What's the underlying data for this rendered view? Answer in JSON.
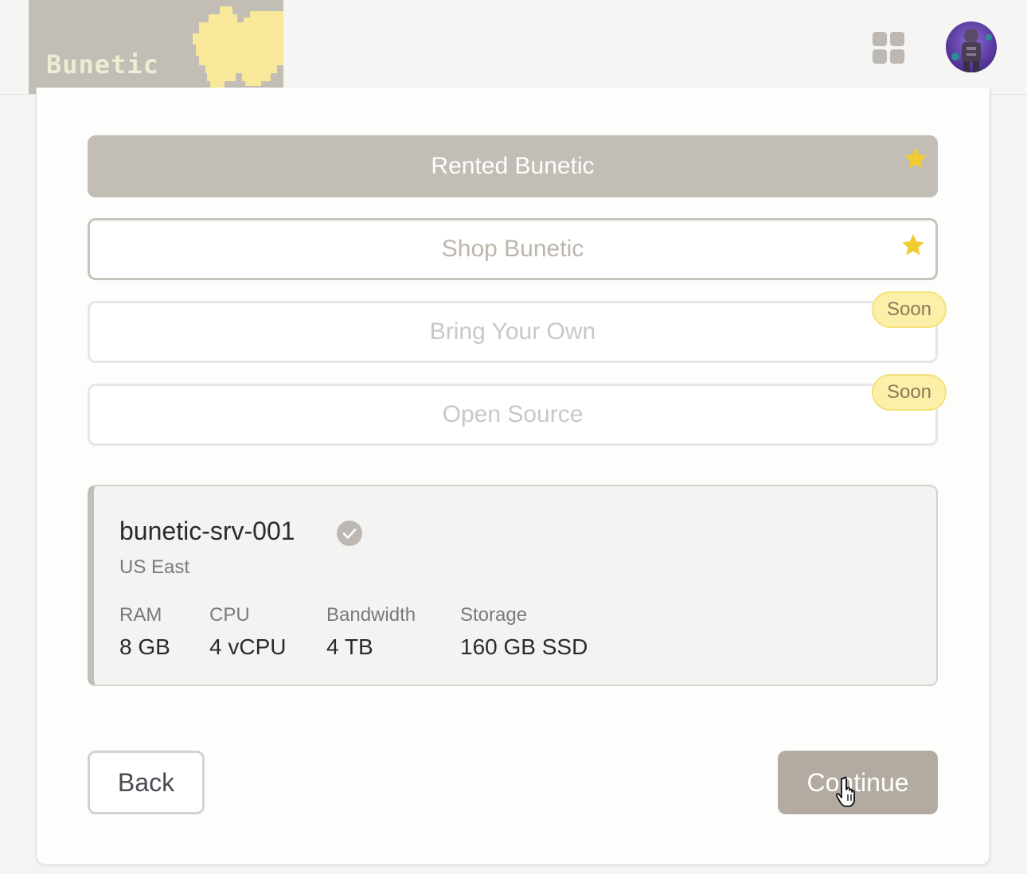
{
  "header": {
    "logo_text": "Bunetic"
  },
  "colors": {
    "accent": "#c2bdb5",
    "star": "#f2cc2e",
    "soon_badge": "#fcefa8"
  },
  "options": [
    {
      "label": "Rented Bunetic",
      "badge": "star-icon"
    },
    {
      "label": "Shop Bunetic",
      "badge": "star-icon"
    },
    {
      "label": "Bring Your Own",
      "badge": "Soon"
    },
    {
      "label": "Open Source",
      "badge": "Soon"
    }
  ],
  "server": {
    "name": "bunetic-srv-001",
    "region": "US East",
    "specs": [
      {
        "label": "RAM",
        "value": "8 GB"
      },
      {
        "label": "CPU",
        "value": "4 vCPU"
      },
      {
        "label": "Bandwidth",
        "value": "4 TB"
      },
      {
        "label": "Storage",
        "value": "160 GB SSD"
      }
    ]
  },
  "footer": {
    "back_label": "Back",
    "continue_label": "Continue"
  }
}
